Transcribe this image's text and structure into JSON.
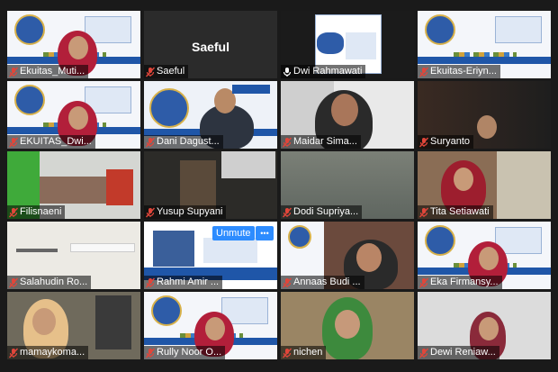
{
  "participants": [
    {
      "name": "Ekuitas_Muti...",
      "type": "poster-person",
      "muted": true
    },
    {
      "name": "Saeful",
      "type": "no-video",
      "muted": true,
      "show_big_name": true
    },
    {
      "name": "Dwi Rahmawati",
      "type": "webinar-poster",
      "muted": false
    },
    {
      "name": "Ekuitas-Eriyn...",
      "type": "poster",
      "muted": true
    },
    {
      "name": "EKUITAS_Dwi...",
      "type": "poster-person",
      "muted": true
    },
    {
      "name": "Dani Dagust...",
      "type": "presenter",
      "muted": true,
      "active_speaker": true
    },
    {
      "name": "Maidar Sima...",
      "type": "person",
      "muted": true
    },
    {
      "name": "Suryanto",
      "type": "person-dark",
      "muted": true
    },
    {
      "name": "Filisnaeni",
      "type": "room",
      "muted": true
    },
    {
      "name": "Yusup Supyani",
      "type": "room-dark",
      "muted": true
    },
    {
      "name": "Dodi Supriya...",
      "type": "room-gray",
      "muted": true
    },
    {
      "name": "Tita Setiawati",
      "type": "person-hijab",
      "muted": true
    },
    {
      "name": "Salahudin Ro...",
      "type": "ceiling",
      "muted": true
    },
    {
      "name": "Rahmi Amir ...",
      "type": "poster-speaker",
      "muted": true,
      "overlay_button": "Unmute",
      "overlay_more": "•••"
    },
    {
      "name": "Annaas Budi ...",
      "type": "person-room",
      "muted": true
    },
    {
      "name": "Eka Firmansy...",
      "type": "poster-person",
      "muted": true
    },
    {
      "name": "mamaykoma...",
      "type": "person-headset",
      "muted": true
    },
    {
      "name": "Rully Noor O...",
      "type": "poster-person",
      "muted": true
    },
    {
      "name": "nichen",
      "type": "person-hijab-green",
      "muted": true
    },
    {
      "name": "Dewi Reniaw...",
      "type": "person-light",
      "muted": true
    }
  ],
  "colors": {
    "background": "#1a1a1a",
    "active_speaker_border": "#e5d24a",
    "muted_icon": "#e0463a",
    "nameplate_bg": "rgba(0,0,0,0.55)",
    "overlay_button": "#2d8cff"
  }
}
